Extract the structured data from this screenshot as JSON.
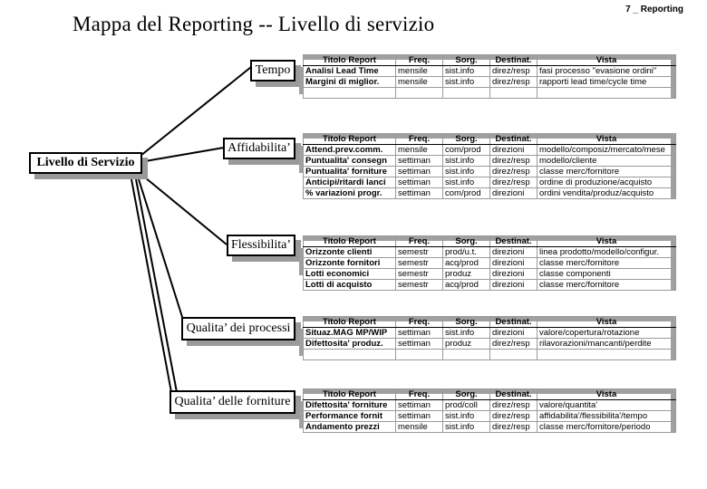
{
  "page_tag": "7 _ Reporting",
  "title": "Mappa del Reporting  --  Livello di servizio",
  "root_node": "Livello di Servizio",
  "columns": [
    "Titolo Report",
    "Freq.",
    "Sorg.",
    "Destinat.",
    "Vista"
  ],
  "categories": [
    {
      "label": "Tempo",
      "rows": [
        [
          "Analisi Lead Time",
          "mensile",
          "sist.info",
          "direz/resp",
          "fasi processo \"evasione ordini\""
        ],
        [
          "Margini di miglior.",
          "mensile",
          "sist.info",
          "direz/resp",
          "rapporti lead time/cycle time"
        ],
        [
          "",
          "",
          "",
          "",
          ""
        ]
      ]
    },
    {
      "label": "Affidabilita’",
      "rows": [
        [
          "Attend.prev.comm.",
          "mensile",
          "com/prod",
          "direzioni",
          "modello/composiz/mercato/mese"
        ],
        [
          "Puntualita' consegn",
          "settiman",
          "sist.info",
          "direz/resp",
          "modello/cliente"
        ],
        [
          "Puntualita' forniture",
          "settiman",
          "sist.info",
          "direz/resp",
          "classe merc/fornitore"
        ],
        [
          "Anticipi/ritardi lanci",
          "settiman",
          "sist.info",
          "direz/resp",
          "ordine di produzione/acquisto"
        ],
        [
          "% variazioni progr.",
          "settiman",
          "com/prod",
          "direzioni",
          "ordini vendita/produz/acquisto"
        ]
      ]
    },
    {
      "label": "Flessibilita’",
      "rows": [
        [
          "Orizzonte clienti",
          "semestr",
          "prod/u.t.",
          "direzioni",
          "linea prodotto/modello/configur."
        ],
        [
          "Orizzonte fornitori",
          "semestr",
          "acq/prod",
          "direzioni",
          "classe merc/fornitore"
        ],
        [
          "Lotti economici",
          "semestr",
          "produz",
          "direzioni",
          "classe componenti"
        ],
        [
          "Lotti di acquisto",
          "semestr",
          "acq/prod",
          "direzioni",
          "classe merc/fornitore"
        ]
      ]
    },
    {
      "label": "Qualita’  dei processi",
      "rows": [
        [
          "Situaz.MAG MP/WIP",
          "settiman",
          "sist.info",
          "direzioni",
          "valore/copertura/rotazione"
        ],
        [
          "Difettosita' produz.",
          "settiman",
          "produz",
          "direz/resp",
          "rilavorazioni/mancanti/perdite"
        ],
        [
          "",
          "",
          "",
          "",
          ""
        ]
      ]
    },
    {
      "label": "Qualita’  delle forniture",
      "rows": [
        [
          "Difettosita' forniture",
          "settiman",
          "prod/coll",
          "direz/resp",
          "valore/quantita'"
        ],
        [
          "Performance fornit",
          "settiman",
          "sist.info",
          "direz/resp",
          "affidabilita'/flessibilita'/tempo"
        ],
        [
          "Andamento prezzi",
          "mensile",
          "sist.info",
          "direz/resp",
          "classe merc/fornitore/periodo"
        ]
      ]
    }
  ]
}
